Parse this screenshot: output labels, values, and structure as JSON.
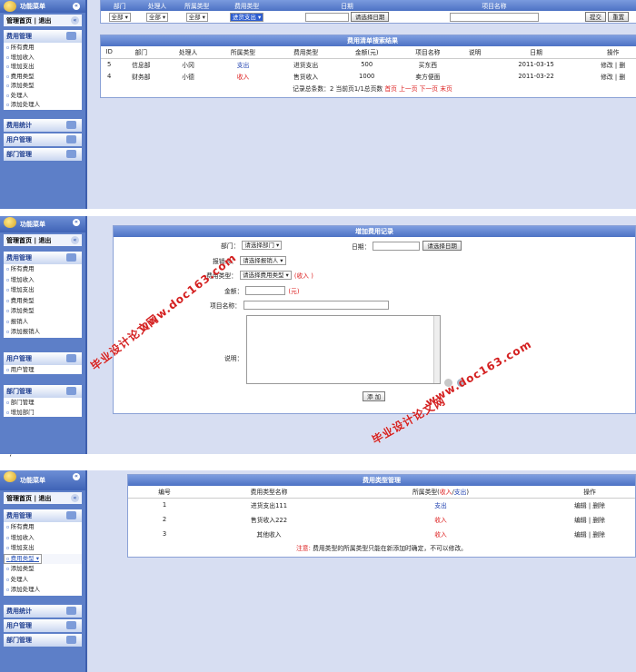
{
  "sidebar": {
    "header_title": "功能菜单",
    "mgmt_home": "管理首页",
    "mgmt_sep": "|",
    "mgmt_exit": "退出",
    "expense_section": "费用管理",
    "items_a": [
      "所有费用",
      "增加收入",
      "增加支出",
      "费用类型",
      "添加类型",
      "处理人",
      "添加处理人"
    ],
    "items_b": [
      "所有费用",
      "增加收入",
      "增加支出",
      "费用类型",
      "添加类型",
      "报销人",
      "添加报销人"
    ],
    "stats": "费用统计",
    "user_mgmt": "用户管理",
    "user_item": "用户管理",
    "dept_mgmt": "部门管理",
    "dept_items": [
      "部门管理",
      "增加部门"
    ]
  },
  "screen1": {
    "filter_headers": [
      "部门",
      "处理人",
      "所属类型",
      "费用类型",
      "日期",
      "项目名称",
      "",
      ""
    ],
    "filter_dept": "全部",
    "filter_handler": "全部",
    "filter_kind": "全部",
    "filter_type": "进货支出",
    "date_button": "请选择日期",
    "submit": "提交",
    "reset": "重置",
    "result_title": "费用清单搜索结果",
    "columns": [
      "ID",
      "部门",
      "处理人",
      "所属类型",
      "费用类型",
      "金额(元)",
      "项目名称",
      "说明",
      "日期",
      "操作"
    ],
    "rows": [
      {
        "id": "5",
        "dept": "信息部",
        "handler": "小冈",
        "kind": "支出",
        "type": "进货支出",
        "amount": "500",
        "project": "买东西",
        "note": "",
        "date": "2011-03-15",
        "ops": "修改 | 删"
      },
      {
        "id": "4",
        "dept": "财务部",
        "handler": "小德",
        "kind": "收入",
        "type": "售货收入",
        "amount": "1000",
        "project": "卖方便面",
        "note": "",
        "date": "2011-03-22",
        "ops": "修改 | 删"
      }
    ],
    "pager_text": "记录总条数：2 当前页1/1总页数",
    "pager_first": "首页",
    "pager_prev": "上一页",
    "pager_next": "下一页",
    "pager_last": "末页"
  },
  "screen2": {
    "title": "增加费用记录",
    "dept_label": "部门：",
    "dept_select": "请选择部门",
    "date_label": "日期：",
    "date_button": "请选择日期",
    "person_label": "报销人：",
    "person_select": "请选择报销人",
    "type_label": "费用类型：",
    "type_select": "请选择费用类型",
    "type_kind": "(收入 )",
    "amount_label": "金额：",
    "amount_unit": "(元)",
    "project_label": "项目名称：",
    "note_label": "说明：",
    "add_button": "添 加"
  },
  "screen3": {
    "title": "费用类型管理",
    "columns": [
      "编号",
      "费用类型名称",
      "所属类型(收入/支出)",
      "操作"
    ],
    "col_kind_prefix": "所属类型(",
    "col_kind_in": "收入",
    "col_kind_slash": "/",
    "col_kind_out": "支出",
    "col_kind_suffix": ")",
    "rows": [
      {
        "no": "1",
        "name": "进货支出111",
        "kind": "支出",
        "ops": "编辑 | 删除"
      },
      {
        "no": "2",
        "name": "售货收入222",
        "kind": "收入",
        "ops": "编辑 | 删除"
      },
      {
        "no": "3",
        "name": "其他收入",
        "kind": "收入",
        "ops": "编辑 | 删除"
      }
    ],
    "note_label": "注意:",
    "note_text": "费用类型的所属类型只能在新添加时确定，不可以修改。"
  },
  "between_mark": "‘",
  "watermark": {
    "line1": "毕业设计论文网",
    "line2": "www.doc163.com"
  },
  "colors": {
    "accent": "#5d7fc8",
    "header": "#4d72c4",
    "red": "#d22222",
    "blue": "#2243b0"
  }
}
